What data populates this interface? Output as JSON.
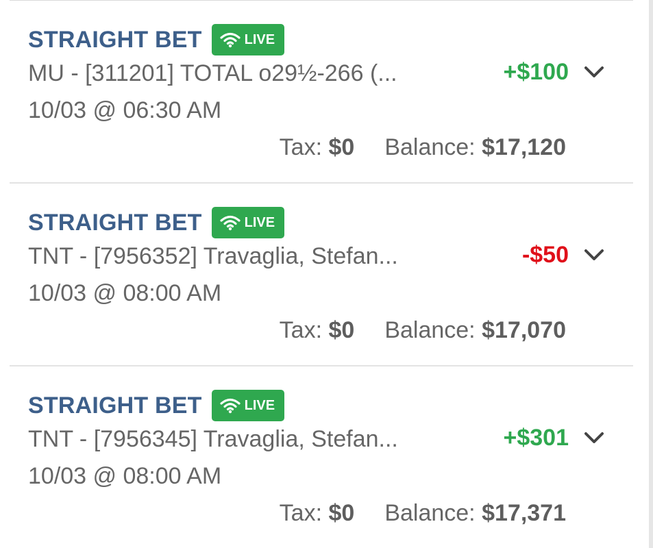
{
  "live_label": "LIVE",
  "tax_label": "Tax:",
  "balance_label": "Balance:",
  "colors": {
    "title": "#3d5f8a",
    "live_badge": "#2fa84f",
    "positive": "#2fa84f",
    "negative": "#e0101a"
  },
  "bets": [
    {
      "type": "STRAIGHT BET",
      "description": "MU - [311201] TOTAL o29½-266 (...",
      "amount": "+$100",
      "amount_sign": "positive",
      "datetime": "10/03 @ 06:30 AM",
      "tax": "$0",
      "balance": "$17,120"
    },
    {
      "type": "STRAIGHT BET",
      "description": "TNT - [7956352] Travaglia, Stefan...",
      "amount": "-$50",
      "amount_sign": "negative",
      "datetime": "10/03 @ 08:00 AM",
      "tax": "$0",
      "balance": "$17,070"
    },
    {
      "type": "STRAIGHT BET",
      "description": "TNT - [7956345] Travaglia, Stefan...",
      "amount": "+$301",
      "amount_sign": "positive",
      "datetime": "10/03 @ 08:00 AM",
      "tax": "$0",
      "balance": "$17,371"
    }
  ]
}
